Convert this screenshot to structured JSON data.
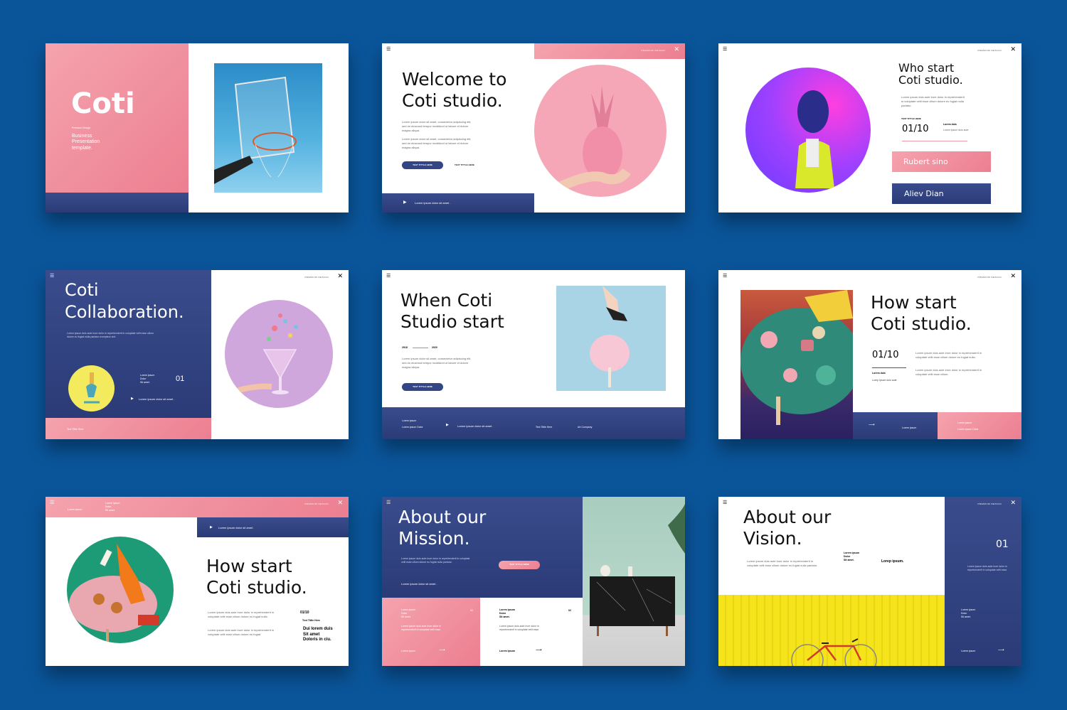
{
  "s1": {
    "title": "Coti",
    "sub": "Premium Design",
    "desc": [
      "Business",
      "Presentation",
      "template."
    ]
  },
  "s2": {
    "title1": "Welcome to",
    "title2": "Coti studio.",
    "brand": "PREMIUM DESIGN",
    "p1": "Lorem ipsum dolor sit amet, consectetur adipiscing elit, sed do eiusmod tempor incididunt ut labore et dolore magna aliqua.",
    "p2": "Lorem ipsum dolor sit amet, consectetur adipiscing elit, sed do eiusmod tempor incididunt ut labore et dolore magna aliqua.",
    "btn": "TEXT TITTLE HERE",
    "btn2": "TEXT TITTLE HERE",
    "footer": "Lorem ipsum dolor sit amet ."
  },
  "s3": {
    "title1": "Who start",
    "title2": "Coti studio.",
    "brand": "PREMIUM DESIGN",
    "para": "Lorem ipsum duis aute irure dolor in reprehenderit in voluptate velit esse cillum dolore eu fugiat nulla pariatur.",
    "label": "TEXT TITTLE HERE",
    "num": "01/10",
    "name_small": "Lorem duis",
    "caption": "Lorem ipsum duis aute",
    "b1": "Rubert sino",
    "b2": "Aliev Dian"
  },
  "s4": {
    "title1": "Coti",
    "title2": "Collaboration.",
    "brand": "PREMIUM DESIGN",
    "para": "Lorem ipsum duis aute irure dolor in reprehenderit in voluptate velit esse cillum dolore eu fugiat nulla pariatur excepteur sint.",
    "l1": "Lorem ipsum",
    "l2": "Dolor",
    "l3": "Sit amet.",
    "num": "01",
    "line": "Lorem ipsum dolor sit amet .",
    "footer": "Text Tittle Here"
  },
  "s5": {
    "title1": "When Coti",
    "title2": "Studio start",
    "y1": "2018",
    "y2": "2020",
    "para": "Lorem ipsum dolor sit amet, consectetur adipiscing elit, sed do eiusmod tempor incididunt ut labore et dolore magna aliqua.",
    "btn": "TEXT TITTLE HERE",
    "f1": "Lorem ipsum",
    "f2": "Lorem ipsum Dolor",
    "f3": "Lorem ipsum dolor sit amet .",
    "f4": "Text Tittle Here",
    "f5": "Art Company"
  },
  "s6": {
    "title1": "How start",
    "title2": "Coti studio.",
    "brand": "PREMIUM DESIGN",
    "num": "01/10",
    "para": "Lorem ipsum duis aute irure dolor in reprehenderit in voluptate velit esse cillum dolore eu fugiat nulla.",
    "para2": "Lorem ipsum duis aute irure dolor in reprehenderit in voluptate velit esse cillum.",
    "l1": "Lorem duis",
    "l2": "Lorep Ipsum duis aute",
    "f1": "Lorem ipsum",
    "f2": "Lorem ipsum",
    "f3": "Lorem ipsum Dolor"
  },
  "s7": {
    "top1": "Lorem ipsum",
    "top2": "Lorem Ipsum",
    "top3": "Dolor",
    "top4": "Sit amet.",
    "brand": "PREMIUM DESIGN",
    "bar": "Lorem ipsum dolor sit amet .",
    "title1": "How start",
    "title2": "Coti studio.",
    "p1": "Lorem ipsum duis aute irure dolor in reprehenderit in voluptate velit esse cillum dolore eu fugiat nulla.",
    "p2": "Lorem ipsum duis aute irure dolor in reprehenderit in voluptate velit esse cillum dolore eu fugiat.",
    "num": "01/10",
    "label": "Text Tittle Here",
    "bold1": "Dui lorem duis",
    "bold2": "Sit amet",
    "bold3": "Doloris in ciu."
  },
  "s8": {
    "title1": "About our",
    "title2": "Mission.",
    "brand": "PREMIUM DESIGN",
    "para": "Lorem ipsum duis aute irure dolor in reprehenderit in voluptate velit esse cillum dolore eu fugiat nulla pariatur.",
    "btn": "TEXT TITTLE HERE",
    "line": "Lorem ipsum dolor sit amet .",
    "c1a": "Lorem ipsum",
    "c1b": "Dolor",
    "c1c": "Sit amet.",
    "c1n": "02",
    "c1p": "Lorem ipsum duis aute irure dolor in reprehenderit in voluptate velit esse.",
    "c1f": "Lorem ipsum",
    "c2a": "Lorem ipsum",
    "c2b": "Dolor",
    "c2c": "Sit amet.",
    "c2n": "02",
    "c2p": "Lorem ipsum duis aute irure dolor in reprehenderit in voluptate velit esse.",
    "c2f": "Lorem ipsum"
  },
  "s9": {
    "title1": "About our",
    "title2": "Vision.",
    "brand": "PREMIUM DESIGN",
    "para": "Lorem ipsum duis aute irure dolor in reprehenderit in voluptate velit esse cillum dolore eu fugiat nulla pariatur.",
    "l1": "Lorem ipsum",
    "l2": "Dolor",
    "l3": "Sit amet.",
    "bold": "Lorep ipsum.",
    "num": "01",
    "rp": "Lorem ipsum duis aute irure dolor in reprehenderit in voluptate velit esse.",
    "r1": "Lorem ipsum",
    "r2": "Dolor",
    "r3": "Sit amet.",
    "rf": "Lorem ipsum"
  }
}
